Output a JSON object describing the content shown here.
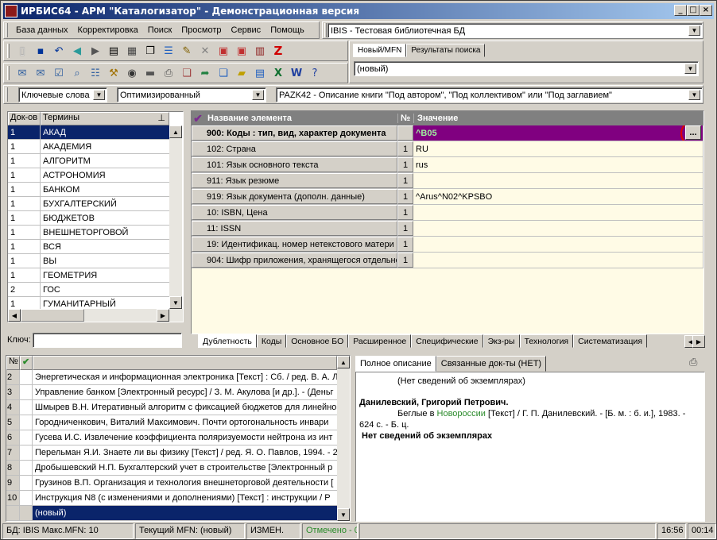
{
  "window": {
    "title": "ИРБИС64 - АРМ \"Каталогизатор\" - Демонстрационная версия",
    "min": "_",
    "max": "□",
    "close": "×"
  },
  "menu": [
    "База данных",
    "Корректировка",
    "Поиск",
    "Просмотр",
    "Сервис",
    "Помощь"
  ],
  "db_select": "IBIS - Тестовая библиотечная БД",
  "right_tabs": [
    "Новый/MFN",
    "Результаты поиска"
  ],
  "record_select": "(новый)",
  "search_row": {
    "index": "Ключевые слова",
    "mode": "Оптимизированный",
    "worksheet": "PAZK42 - Описание книги \"Под автором\", \"Под коллективом\" или \"Под заглавием\""
  },
  "terms": {
    "headers": [
      "Док-ов",
      "Термины"
    ],
    "rows": [
      [
        "1",
        "АКАД"
      ],
      [
        "1",
        "АКАДЕМИЯ"
      ],
      [
        "1",
        "АЛГОРИТМ"
      ],
      [
        "1",
        "АСТРОНОМИЯ"
      ],
      [
        "1",
        "БАНКОМ"
      ],
      [
        "1",
        "БУХГАЛТЕРСКИЙ"
      ],
      [
        "1",
        "БЮДЖЕТОВ"
      ],
      [
        "1",
        "ВНЕШНЕТОРГОВОЙ"
      ],
      [
        "1",
        "ВСЯ"
      ],
      [
        "1",
        "ВЫ"
      ],
      [
        "1",
        "ГЕОМЕТРИЯ"
      ],
      [
        "2",
        "ГОС"
      ],
      [
        "1",
        "ГУМАНИТАРНЫЙ"
      ]
    ],
    "key_label": "Ключ:"
  },
  "editor": {
    "headers": [
      "Название элемента",
      "№",
      "Значение"
    ],
    "rows": [
      {
        "name": "900: Коды : тип, вид, характер документа",
        "num": "",
        "value": "^B05"
      },
      {
        "name": "102: Страна",
        "num": "1",
        "value": "RU"
      },
      {
        "name": "101: Язык основного текста",
        "num": "1",
        "value": "rus"
      },
      {
        "name": "911: Язык резюме",
        "num": "1",
        "value": ""
      },
      {
        "name": "919: Язык документа (дополн. данные)",
        "num": "1",
        "value": "^Arus^N02^KPSBO"
      },
      {
        "name": "10: ISBN, Цена",
        "num": "1",
        "value": ""
      },
      {
        "name": "11: ISSN",
        "num": "1",
        "value": ""
      },
      {
        "name": "19: Идентификац. номер нетекстового матери",
        "num": "1",
        "value": ""
      },
      {
        "name": "904: Шифр приложения, хранящегося отдельно",
        "num": "1",
        "value": ""
      }
    ],
    "ellipsis": "...",
    "tabs": [
      "Дублетность",
      "Коды",
      "Основное БО",
      "Расширенное",
      "Специфические",
      "Экз-ры",
      "Технология",
      "Систематизация"
    ]
  },
  "results": {
    "headers": [
      "№",
      "✔"
    ],
    "rows": [
      [
        "2",
        "Энергетическая и информационная электроника [Текст] : Сб. / ред. В. А. Л"
      ],
      [
        "3",
        "Управление банком [Электронный ресурс]  / З. М. Акулова [и др.]. - (Деньг"
      ],
      [
        "4",
        "Шмырев В.Н. Итеративный алгоритм с фиксацией бюджетов для линейно"
      ],
      [
        "5",
        "Городниченкович, Виталий Максимович. Почти ортогональность инвари"
      ],
      [
        "6",
        "Гусева И.С. Извлечение коэффициента поляризуемости нейтрона из инт"
      ],
      [
        "7",
        "Перельман Я.И. Знаете ли вы физику [Текст] / ред. Я. О. Павлов, 1994. - 2"
      ],
      [
        "8",
        "Дробышевский Н.П. Бухгалтерский учет в строительстве [Электронный р"
      ],
      [
        "9",
        "Грузинов В.П. Организация и технология внешнеторговой деятельности ["
      ],
      [
        "10",
        "Инструкция N8   (с изменениями и дополнениями) [Текст] : инструкции / Р"
      ]
    ],
    "new_row": "(новый)"
  },
  "desc": {
    "tabs": [
      "Полное описание",
      "Связанные док-ты (НЕТ)"
    ],
    "line1": "(Нет сведений об экземплярах)",
    "author": "Данилевский, Григорий Петрович.",
    "body_a": "Беглые в ",
    "body_link": "Новороссии",
    "body_b": " [Текст] / Г. П. Данилевский. - [Б. м. : б. и.], 1983. -",
    "body_c": "624 с. - Б. ц.",
    "line_last": "Нет сведений об экземплярах"
  },
  "status": {
    "db": "БД: IBIS Макс.MFN: 10",
    "mfn": "Текущий MFN: (новый)",
    "changed": "ИЗМЕН.",
    "marked": "Отмечено - 0",
    "time": "16:56",
    "num": "00:14"
  }
}
